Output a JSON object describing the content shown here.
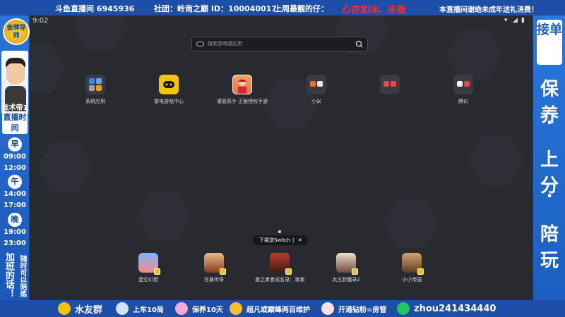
{
  "top_banner": {
    "room": "斗鱼直播间 6945936",
    "club": "社团：岭南之巅 ID：100040017",
    "best_label": "上周最靓的仔：",
    "best_names": "心亦如冰、未崔",
    "notice": "本直播间谢绝未成年送礼消费！"
  },
  "left_panel": {
    "badge": "金牌导师",
    "streamer": "技术帝1",
    "schedule_title": "直播时间",
    "schedule": [
      {
        "mark": "早",
        "time": "09:00"
      },
      {
        "mark": "",
        "time": "12:00"
      },
      {
        "mark": "午",
        "time": "14:00"
      },
      {
        "mark": "",
        "time": "17:00"
      },
      {
        "mark": "晚",
        "time": "19:00"
      },
      {
        "mark": "",
        "time": "23:00"
      }
    ],
    "note_a": "加班的话！",
    "note_b": "随时可以陪练"
  },
  "right_panel": {
    "tag": "接单",
    "words": [
      "保养",
      "上分",
      "陪玩"
    ]
  },
  "bottom_bar": {
    "items": [
      "水友群",
      "上车10局",
      "保养10天",
      "超凡或巅峰两百维护",
      "开通钻粉=房管",
      "zhou241434440"
    ]
  },
  "screen": {
    "clock": "9:02",
    "search_placeholder": "搜索游戏或应用",
    "apps_row1": [
      {
        "label": "系统应用",
        "icon": "folder-icon"
      },
      {
        "label": "雷电游戏中心",
        "icon": "gamepad-icon"
      },
      {
        "label": "灌篮高手 正版授权手游",
        "icon": "slamdunk-icon"
      },
      {
        "label": "小米",
        "icon": "folder-icon"
      },
      {
        "label": "",
        "icon": "folder-icon"
      },
      {
        "label": "腾讯",
        "icon": "folder-icon"
      }
    ],
    "apps_row2": [
      {
        "label": "蓝空幻想",
        "icon": "game-icon"
      },
      {
        "label": "狂暴传奇",
        "icon": "game-icon"
      },
      {
        "label": "盾之勇者成名录：浪潮",
        "icon": "game-icon"
      },
      {
        "label": "太古封魔录2",
        "icon": "game-icon"
      },
      {
        "label": "小小帝国",
        "icon": "game-icon"
      }
    ],
    "download_pill": "下载送Switch",
    "colors": {
      "accent": "#f5c400",
      "screen_bg": "#292a30",
      "frame": "#1d4fa8"
    }
  }
}
